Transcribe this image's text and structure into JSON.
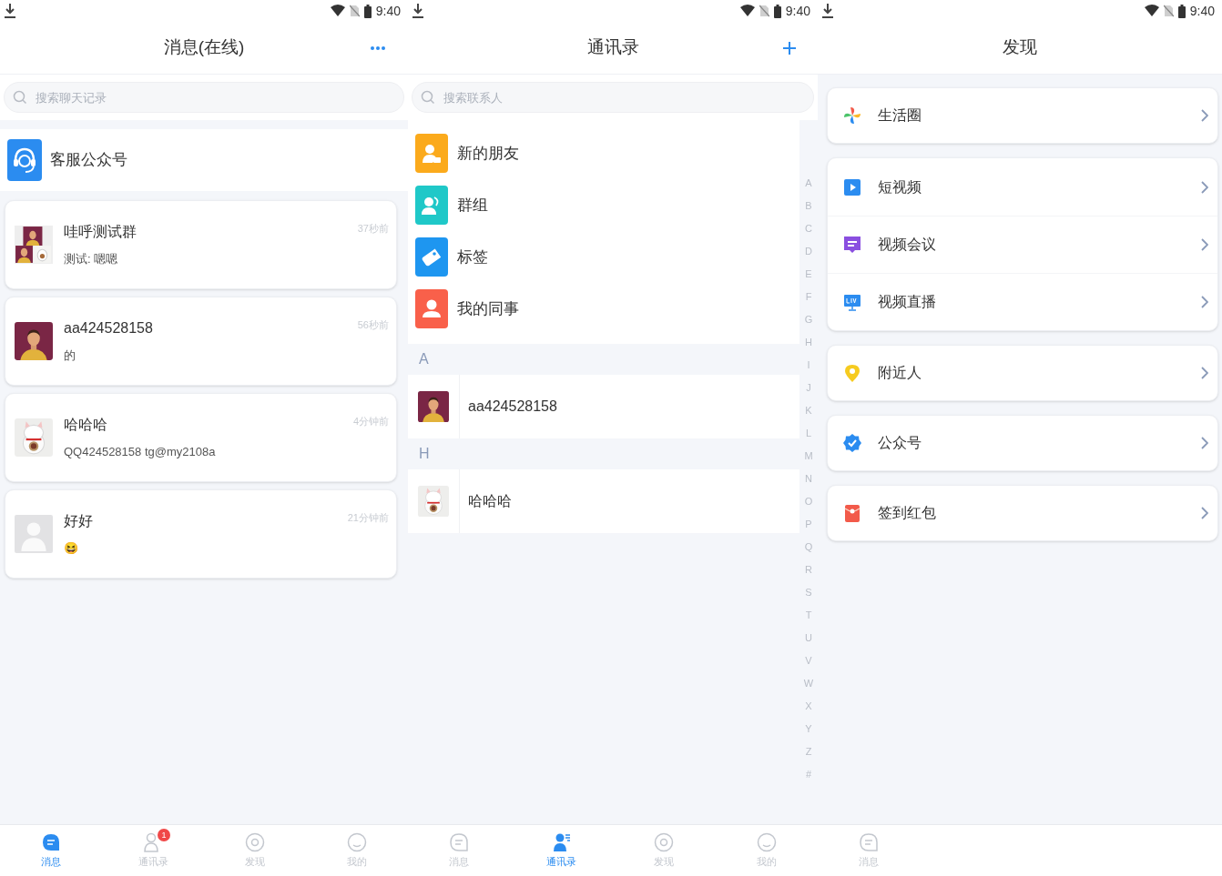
{
  "screens": [
    {
      "kind": "messages",
      "status_bar": {
        "time": "9:40"
      },
      "title": "消息(在线)",
      "search": {
        "placeholder": "搜索聊天记录"
      },
      "pinned": {
        "name": "客服公众号"
      },
      "chats": [
        {
          "kind": "group",
          "name": "哇呼测试群",
          "preview": "测试: 嗯嗯",
          "time": "37秒前"
        },
        {
          "kind": "person",
          "name": "aa424528158",
          "preview": "的",
          "time": "56秒前"
        },
        {
          "kind": "cat",
          "name": "哈哈哈",
          "preview": "QQ424528158 tg@my2108a",
          "time": "4分钟前"
        },
        {
          "kind": "default",
          "name": "好好",
          "preview": "😆",
          "time": "21分钟前"
        }
      ],
      "tabs": [
        {
          "kind": "message",
          "label": "消息",
          "selected": true
        },
        {
          "kind": "contacts",
          "label": "通讯录",
          "selected": false,
          "badge": "1"
        },
        {
          "kind": "discover",
          "label": "发现",
          "selected": false
        },
        {
          "kind": "me",
          "label": "我的",
          "selected": false
        }
      ]
    },
    {
      "kind": "contacts",
      "status_bar": {
        "time": "9:40"
      },
      "title": "通讯录",
      "search": {
        "placeholder": "搜索联系人"
      },
      "functions": [
        {
          "kind": "new-friend",
          "label": "新的朋友",
          "color": "#fbaa1c"
        },
        {
          "kind": "group",
          "label": "群组",
          "color": "#1fc8c8"
        },
        {
          "kind": "tag",
          "label": "标签",
          "color": "#1e96f0"
        },
        {
          "kind": "colleague",
          "label": "我的同事",
          "color": "#f9604a"
        }
      ],
      "sections": [
        {
          "letter": "A",
          "contacts": [
            {
              "kind": "person",
              "name": "aa424528158"
            }
          ]
        },
        {
          "letter": "H",
          "contacts": [
            {
              "kind": "cat",
              "name": "哈哈哈"
            }
          ]
        }
      ],
      "index": [
        "A",
        "B",
        "C",
        "D",
        "E",
        "F",
        "G",
        "H",
        "I",
        "J",
        "K",
        "L",
        "M",
        "N",
        "O",
        "P",
        "Q",
        "R",
        "S",
        "T",
        "U",
        "V",
        "W",
        "X",
        "Y",
        "Z",
        "#"
      ],
      "tabs": [
        {
          "kind": "message",
          "label": "消息",
          "selected": false
        },
        {
          "kind": "contacts",
          "label": "通讯录",
          "selected": true
        },
        {
          "kind": "discover",
          "label": "发现",
          "selected": false
        },
        {
          "kind": "me",
          "label": "我的",
          "selected": false
        }
      ]
    },
    {
      "kind": "discover",
      "status_bar": {
        "time": "9:40"
      },
      "title": "发现",
      "groups": [
        [
          {
            "kind": "pinwheel",
            "label": "生活圈"
          }
        ],
        [
          {
            "kind": "play",
            "label": "短视频"
          },
          {
            "kind": "meeting",
            "label": "视频会议"
          },
          {
            "kind": "live",
            "label": "视频直播"
          }
        ],
        [
          {
            "kind": "pin",
            "label": "附近人"
          }
        ],
        [
          {
            "kind": "badge",
            "label": "公众号"
          }
        ],
        [
          {
            "kind": "envelope",
            "label": "签到红包"
          }
        ]
      ],
      "tabs": [
        {
          "kind": "message",
          "label": "消息",
          "selected": false
        }
      ]
    }
  ]
}
